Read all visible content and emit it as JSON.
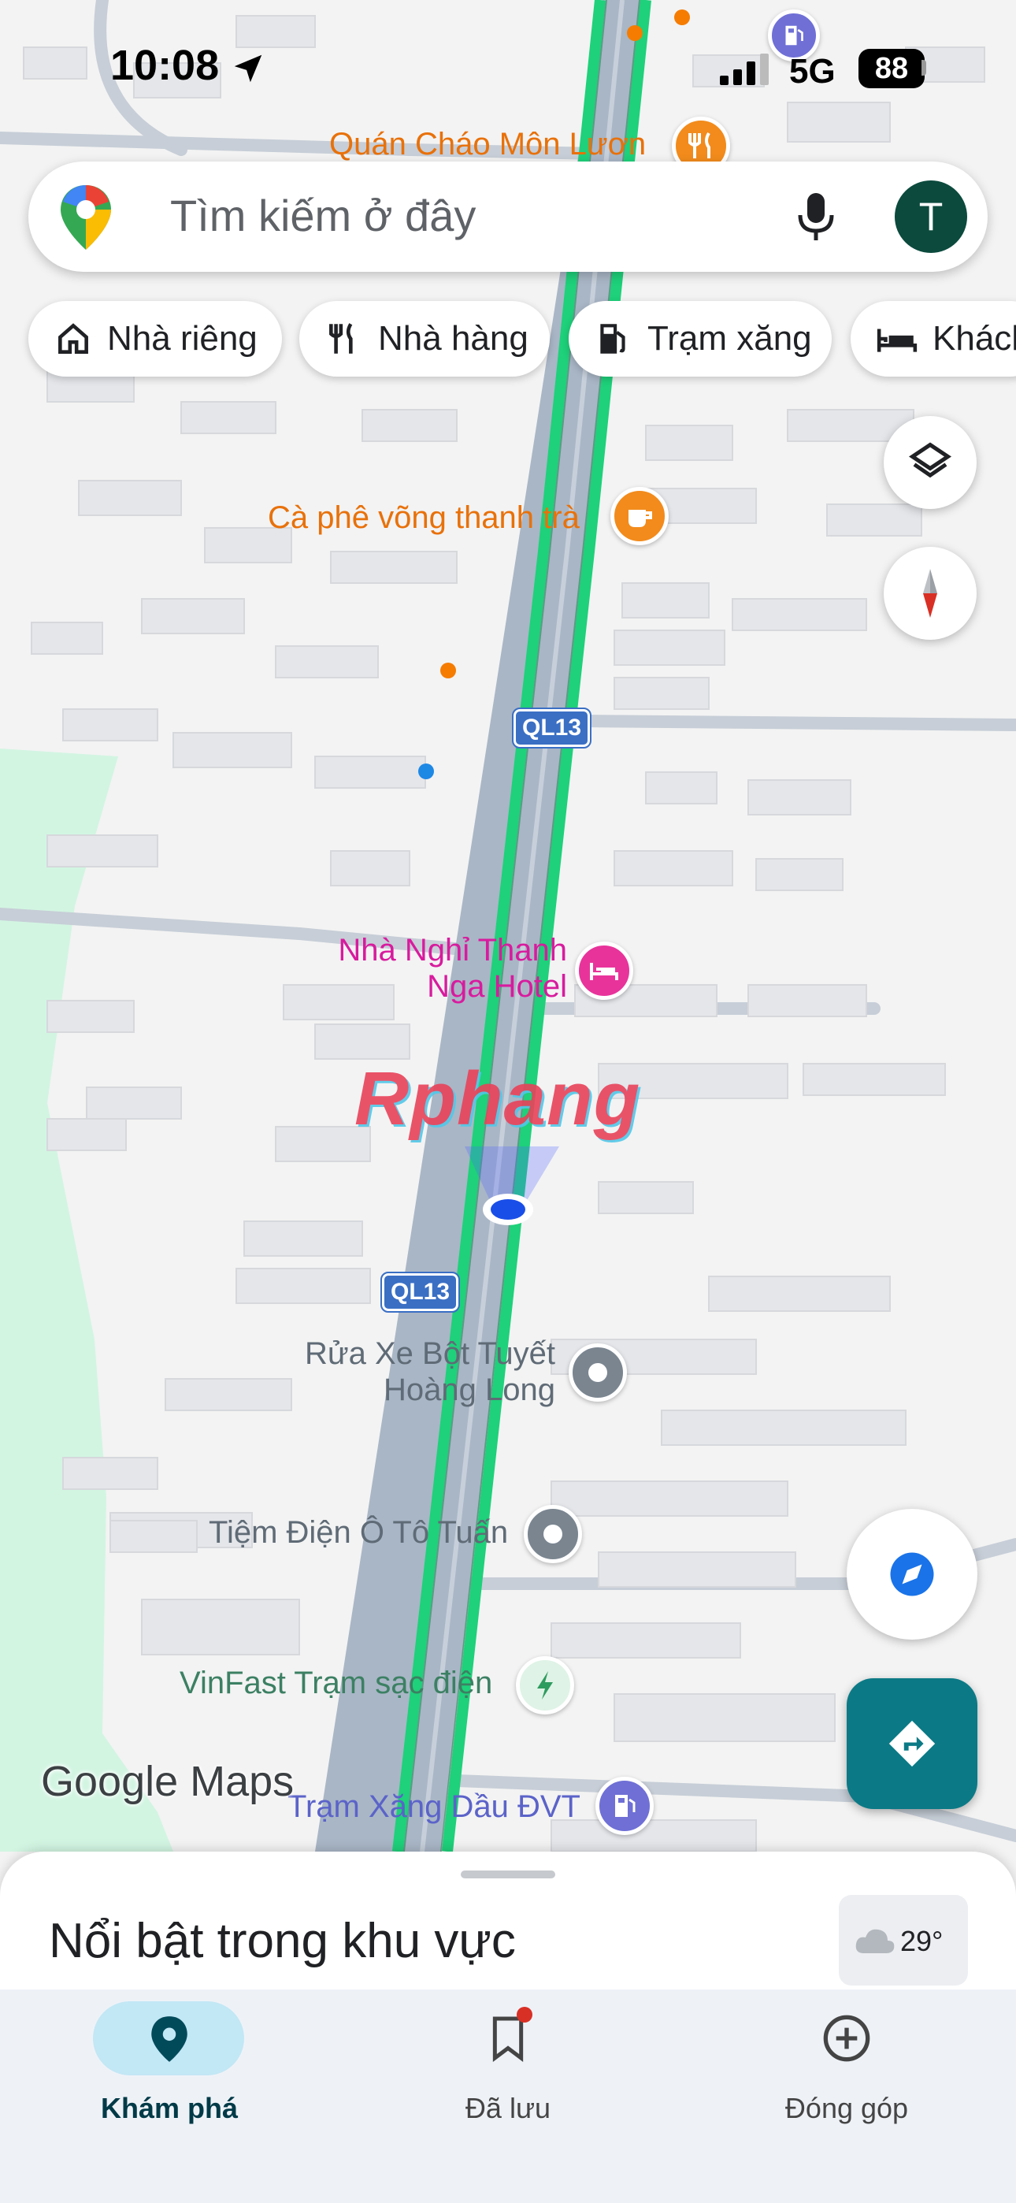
{
  "status_bar": {
    "time": "10:08",
    "network": "5G",
    "battery": "88"
  },
  "search": {
    "placeholder": "Tìm kiếm ở đây",
    "avatar_letter": "T"
  },
  "chips": [
    {
      "label": "Nhà riêng",
      "icon": "home-icon"
    },
    {
      "label": "Nhà hàng",
      "icon": "restaurant-icon"
    },
    {
      "label": "Trạm xăng",
      "icon": "gas-station-icon"
    },
    {
      "label": "Khách",
      "icon": "hotel-icon"
    }
  ],
  "map": {
    "places": [
      {
        "name": "Quán Cháo Môn Lươn",
        "color": "#e8710a",
        "icon": "restaurant-icon"
      },
      {
        "name": "Cà phê võng thanh trà",
        "color": "#e8710a",
        "icon": "cafe-icon"
      },
      {
        "name": "Nhà Nghỉ Thanh Nga Hotel",
        "color": "#d81b9e",
        "icon": "hotel-icon"
      },
      {
        "name": "Rửa Xe Bột Tuyết Hoàng Long",
        "color": "#5f6b76",
        "icon": "pin-icon"
      },
      {
        "name": "Tiệm Điện Ô Tô Tuấn",
        "color": "#5f6b76",
        "icon": "pin-icon"
      },
      {
        "name": "VinFast Trạm sạc điện",
        "color": "#3c8063",
        "icon": "charging-icon"
      },
      {
        "name": "Trạm Xăng Dầu ĐVT",
        "color": "#5b63c9",
        "icon": "gas-station-icon"
      }
    ],
    "road_shields": [
      "QL13",
      "QL13"
    ],
    "watermark": "Rphang",
    "logo": "Google Maps"
  },
  "sheet": {
    "title": "Nổi bật trong khu vực",
    "weather": "29°"
  },
  "nav": [
    {
      "label": "Khám phá",
      "icon": "explore-pin-icon",
      "active": true
    },
    {
      "label": "Đã lưu",
      "icon": "bookmark-icon",
      "active": false
    },
    {
      "label": "Đóng góp",
      "icon": "add-circle-icon",
      "active": false
    }
  ],
  "colors": {
    "accent": "#0b7a86",
    "traffic_green": "#1ed17a",
    "road": "#a9b6c6",
    "nav_active_bg": "#c2e7f5"
  }
}
